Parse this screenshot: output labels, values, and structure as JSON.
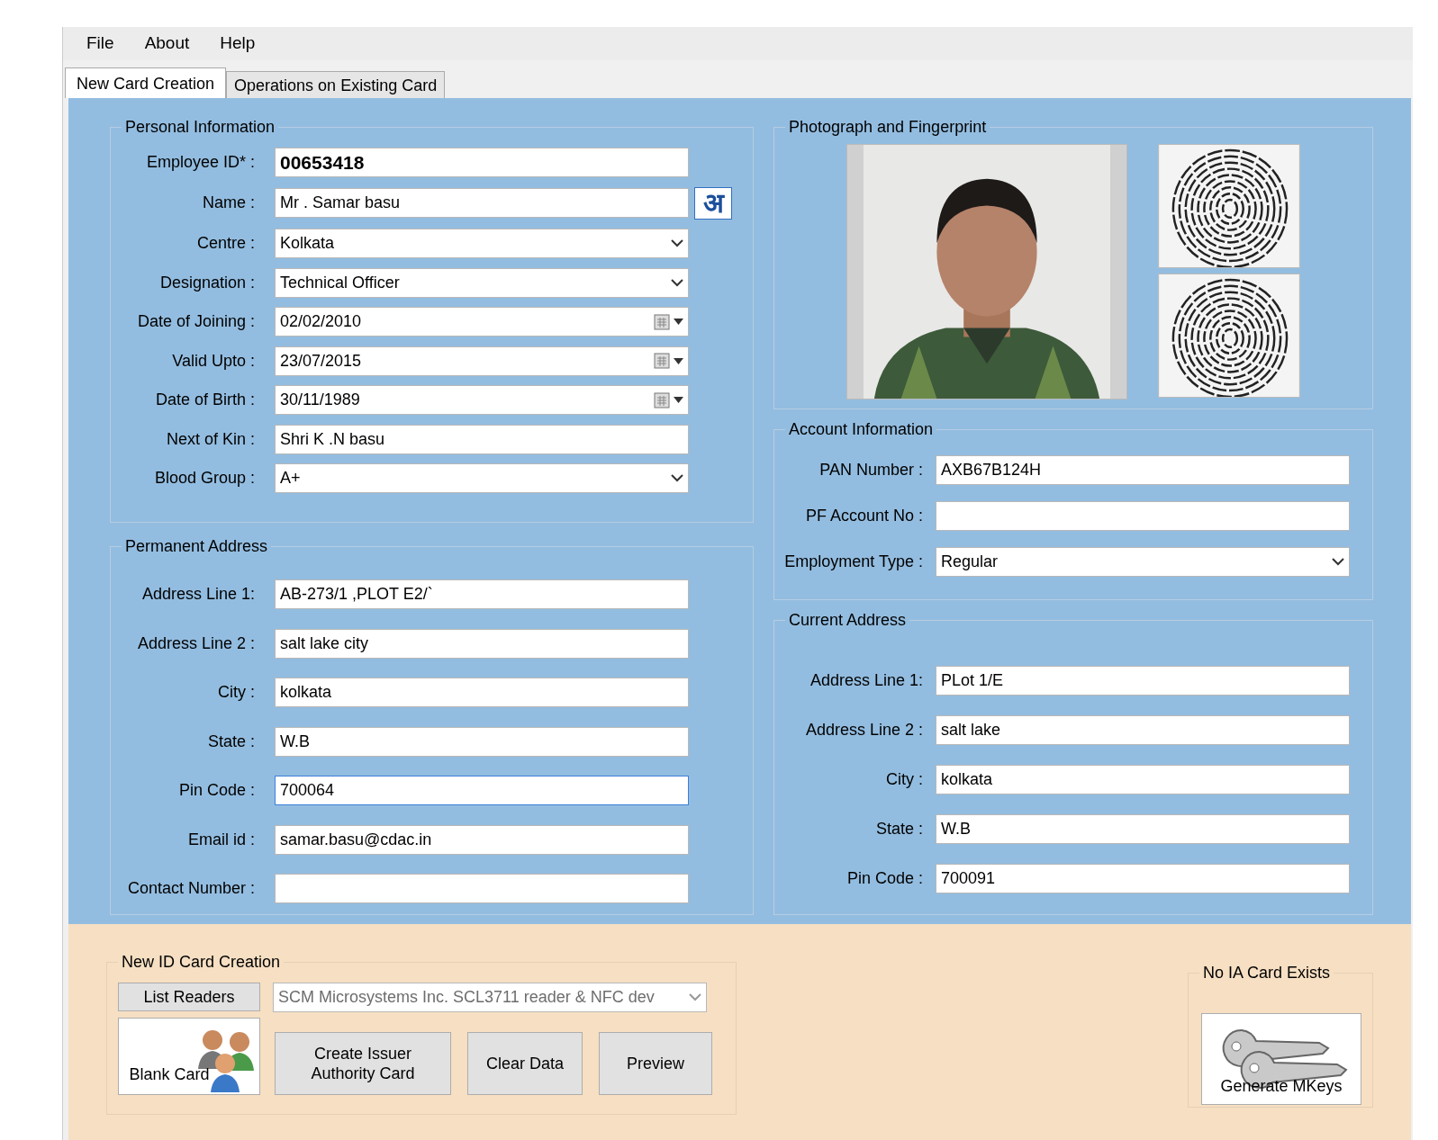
{
  "menu": [
    "File",
    "About",
    "Help"
  ],
  "tabs": [
    {
      "label": "New Card Creation",
      "selected": true
    },
    {
      "label": "Operations on Existing Card",
      "selected": false
    }
  ],
  "personal_information": {
    "title": "Personal Information",
    "fields": [
      {
        "label": "Employee ID* :",
        "kind": "text",
        "value": "00653418",
        "bold": true
      },
      {
        "label": "Name :",
        "kind": "text",
        "value": "Mr . Samar basu",
        "button_text": "अ"
      },
      {
        "label": "Centre :",
        "kind": "combo",
        "value": "Kolkata"
      },
      {
        "label": "Designation :",
        "kind": "combo",
        "value": "Technical Officer"
      },
      {
        "label": "Date of Joining :",
        "kind": "date",
        "value": "02/02/2010"
      },
      {
        "label": "Valid Upto :",
        "kind": "date",
        "value": "23/07/2015"
      },
      {
        "label": "Date of Birth :",
        "kind": "date",
        "value": "30/11/1989"
      },
      {
        "label": "Next of Kin :",
        "kind": "text",
        "value": "Shri K .N basu"
      },
      {
        "label": "Blood Group :",
        "kind": "combo",
        "value": "A+"
      }
    ]
  },
  "permanent_address": {
    "title": "Permanent Address",
    "fields": [
      {
        "label": "Address Line 1:",
        "kind": "text",
        "value": "AB-273/1 ,PLOT E2/`"
      },
      {
        "label": "Address Line 2 :",
        "kind": "text",
        "value": "salt lake city"
      },
      {
        "label": "City :",
        "kind": "text",
        "value": "kolkata"
      },
      {
        "label": "State :",
        "kind": "text",
        "value": "W.B"
      },
      {
        "label": "Pin Code :",
        "kind": "text",
        "value": "700064",
        "focused": true
      },
      {
        "label": "Email id :",
        "kind": "text",
        "value": "samar.basu@cdac.in"
      },
      {
        "label": "Contact Number :",
        "kind": "text"
      }
    ]
  },
  "photograph_and_fingerprint": {
    "title": "Photograph and Fingerprint"
  },
  "account_information": {
    "title": "Account Information",
    "fields": [
      {
        "label": "PAN Number :",
        "kind": "text",
        "value": "AXB67B124H"
      },
      {
        "label": "PF Account No :",
        "kind": "text"
      },
      {
        "label": "Employment Type :",
        "kind": "combo",
        "value": "Regular"
      }
    ]
  },
  "current_address": {
    "title": "Current Address",
    "fields": [
      {
        "label": "Address Line 1:",
        "kind": "text",
        "value": "PLot 1/E"
      },
      {
        "label": "Address Line 2 :",
        "kind": "text",
        "value": "salt lake"
      },
      {
        "label": "City :",
        "kind": "text",
        "value": "kolkata"
      },
      {
        "label": "State :",
        "kind": "text",
        "value": "W.B"
      },
      {
        "label": "Pin Code :",
        "kind": "text",
        "value": "700091"
      }
    ]
  },
  "new_id_card_creation": {
    "title": "New ID Card  Creation",
    "list_readers_button": "List Readers",
    "reader": "SCM Microsystems Inc. SCL3711 reader & NFC dev",
    "buttons": [
      {
        "kind": "blank_card",
        "label": "Blank Card"
      },
      {
        "kind": "plain",
        "label": "Create Issuer\nAuthority Card"
      },
      {
        "kind": "plain",
        "label": "Clear Data"
      },
      {
        "kind": "plain",
        "label": "Preview"
      }
    ]
  },
  "ia_card": {
    "title": "No IA Card Exists",
    "button": "Generate MKeys"
  }
}
